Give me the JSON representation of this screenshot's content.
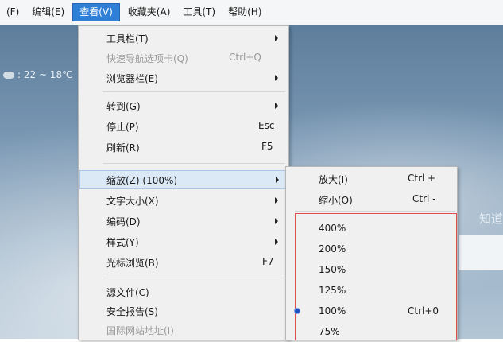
{
  "menubar": {
    "items": [
      "(F)",
      "编辑(E)",
      "查看(V)",
      "收藏夹(A)",
      "工具(T)",
      "帮助(H)"
    ]
  },
  "background": {
    "weather_text": ": 22 ~ 18℃",
    "right_text": "知道"
  },
  "view_menu": {
    "items": [
      {
        "label": "工具栏(T)",
        "shortcut": "",
        "submenu": true,
        "disabled": false
      },
      {
        "label": "快速导航选项卡(Q)",
        "shortcut": "Ctrl+Q",
        "submenu": false,
        "disabled": true
      },
      {
        "label": "浏览器栏(E)",
        "shortcut": "",
        "submenu": true,
        "disabled": false
      },
      {
        "label": "转到(G)",
        "shortcut": "",
        "submenu": true,
        "disabled": false
      },
      {
        "label": "停止(P)",
        "shortcut": "Esc",
        "submenu": false,
        "disabled": false
      },
      {
        "label": "刷新(R)",
        "shortcut": "F5",
        "submenu": false,
        "disabled": false
      },
      {
        "label": "缩放(Z) (100%)",
        "shortcut": "",
        "submenu": true,
        "disabled": false,
        "highlight": true
      },
      {
        "label": "文字大小(X)",
        "shortcut": "",
        "submenu": true,
        "disabled": false
      },
      {
        "label": "编码(D)",
        "shortcut": "",
        "submenu": true,
        "disabled": false
      },
      {
        "label": "样式(Y)",
        "shortcut": "",
        "submenu": true,
        "disabled": false
      },
      {
        "label": "光标浏览(B)",
        "shortcut": "F7",
        "submenu": false,
        "disabled": false
      },
      {
        "label": "源文件(C)",
        "shortcut": "",
        "submenu": false,
        "disabled": false
      },
      {
        "label": "安全报告(S)",
        "shortcut": "",
        "submenu": false,
        "disabled": false
      },
      {
        "label": "国际网站地址(I)",
        "shortcut": "",
        "submenu": false,
        "disabled": true
      }
    ]
  },
  "zoom_submenu": {
    "items": [
      {
        "label": "放大(I)",
        "shortcut": "Ctrl +"
      },
      {
        "label": "缩小(O)",
        "shortcut": "Ctrl -"
      },
      {
        "label": "400%",
        "shortcut": ""
      },
      {
        "label": "200%",
        "shortcut": ""
      },
      {
        "label": "150%",
        "shortcut": ""
      },
      {
        "label": "125%",
        "shortcut": ""
      },
      {
        "label": "100%",
        "shortcut": "Ctrl+0",
        "selected": true
      },
      {
        "label": "75%",
        "shortcut": ""
      }
    ]
  }
}
